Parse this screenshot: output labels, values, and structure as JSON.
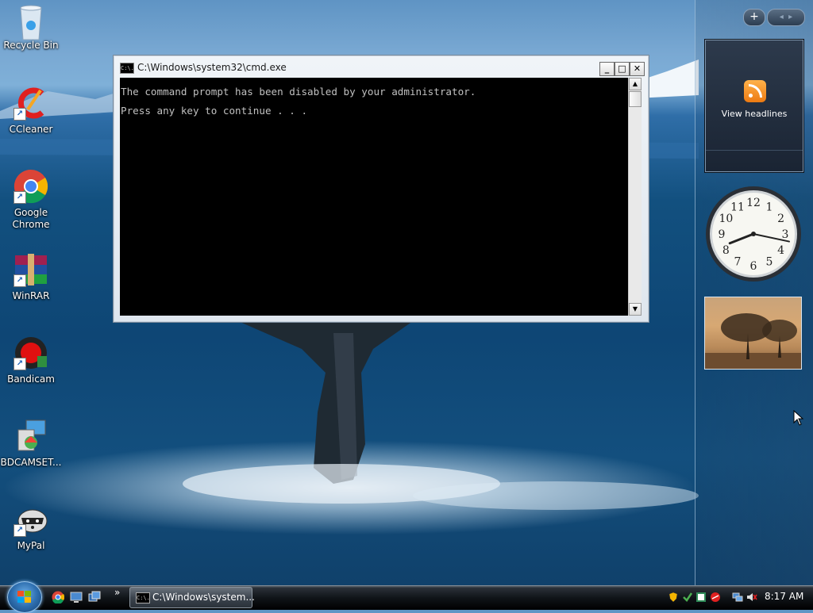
{
  "desktop": {
    "icons": [
      {
        "label": "Recycle Bin"
      },
      {
        "label": "CCleaner"
      },
      {
        "label": "Google Chrome"
      },
      {
        "label": "WinRAR"
      },
      {
        "label": "Bandicam"
      },
      {
        "label": "BDCAMSET..."
      },
      {
        "label": "MyPal"
      }
    ]
  },
  "cmd_window": {
    "title": "C:\\Windows\\system32\\cmd.exe",
    "app_icon_text": "C:\\.",
    "lines": [
      "The command prompt has been disabled by your administrator.",
      "Press any key to continue . . ."
    ],
    "minimize": "_",
    "maximize": "□",
    "close": "✕"
  },
  "sidebar": {
    "add_gadget": "+",
    "prev": "◂",
    "next": "▸",
    "feed_label": "View headlines",
    "clock_numbers": [
      "12",
      "1",
      "2",
      "3",
      "4",
      "5",
      "6",
      "7",
      "8",
      "9",
      "10",
      "11"
    ],
    "clock_time": {
      "hours": 8,
      "minutes": 17
    }
  },
  "taskbar": {
    "overflow": "»",
    "cmd_task_label": "C:\\Windows\\system...",
    "clock": "8:17 AM"
  },
  "colors": {
    "console_bg": "#000000",
    "console_text": "#c0c0c0",
    "taskbar_bg": "#101418"
  }
}
